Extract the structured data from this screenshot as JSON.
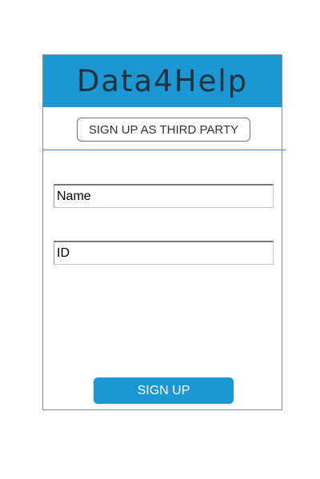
{
  "header": {
    "title": "Data4Help",
    "background_color": "#1b98d3"
  },
  "mode_button": {
    "label": "SIGN UP AS THIRD PARTY"
  },
  "form": {
    "name_value": "Name",
    "id_value": "ID"
  },
  "submit_button": {
    "label": "SIGN UP",
    "background_color": "#1b98d3"
  }
}
